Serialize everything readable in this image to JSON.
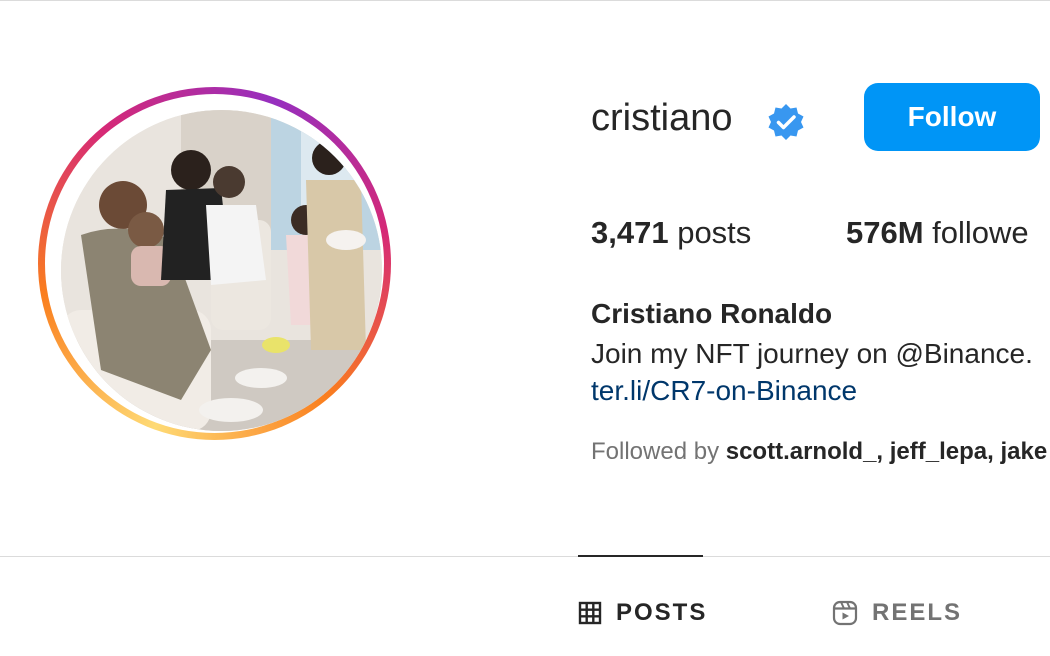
{
  "profile": {
    "username": "cristiano",
    "follow_label": "Follow",
    "posts_count": "3,471",
    "posts_label": "posts",
    "followers_count": "576M",
    "followers_label": "followe",
    "full_name": "Cristiano Ronaldo",
    "bio": "Join my NFT journey on @Binance.",
    "link": "ter.li/CR7-on-Binance",
    "followed_by_prefix": "Followed by",
    "followed_by_names": "scott.arnold_, jeff_lepa, jake"
  },
  "tabs": [
    {
      "label": "POSTS",
      "icon": "grid-icon",
      "active": true
    },
    {
      "label": "REELS",
      "icon": "reels-icon",
      "active": false
    }
  ],
  "colors": {
    "follow_button": "#0095f6",
    "verified_badge": "#3897f0",
    "link": "#00376b",
    "secondary_text": "#737373"
  }
}
